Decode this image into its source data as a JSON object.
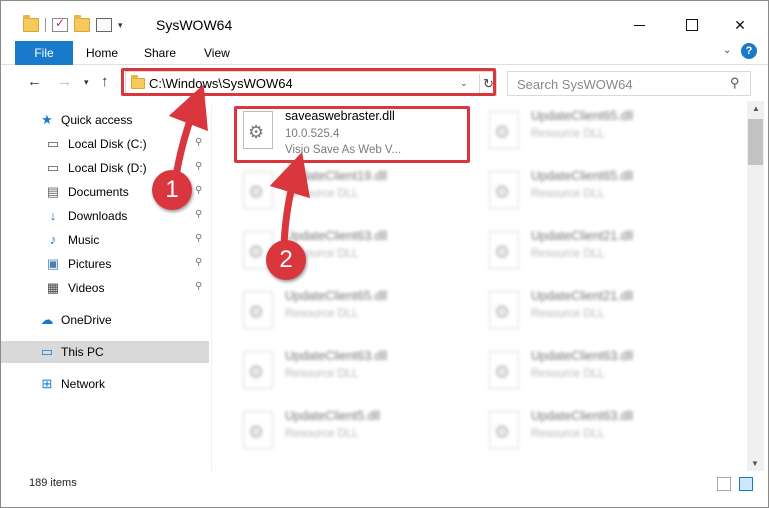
{
  "window": {
    "title": "SysWOW64",
    "minimize_glyph": "",
    "maximize_glyph": "",
    "close_glyph": "✕"
  },
  "ribbon": {
    "tabs": [
      "File",
      "Home",
      "Share",
      "View"
    ],
    "collapse_glyph": "⌄",
    "help_glyph": "?"
  },
  "nav": {
    "back_glyph": "←",
    "forward_glyph": "→",
    "recent_glyph": "▾",
    "up_glyph": "↑",
    "address": "C:\\Windows\\SysWOW64",
    "address_dropdown_glyph": "⌄",
    "refresh_glyph": "↻",
    "search_placeholder": "Search SysWOW64",
    "search_glyph": "⚲"
  },
  "sidebar": {
    "quick_access": "Quick access",
    "pinned": [
      {
        "label": "Local Disk (C:)",
        "icon": "drive-icon"
      },
      {
        "label": "Local Disk (D:)",
        "icon": "drive-icon"
      },
      {
        "label": "Documents",
        "icon": "documents-icon"
      },
      {
        "label": "Downloads",
        "icon": "downloads-icon"
      },
      {
        "label": "Music",
        "icon": "music-icon"
      },
      {
        "label": "Pictures",
        "icon": "pictures-icon"
      },
      {
        "label": "Videos",
        "icon": "videos-icon"
      }
    ],
    "onedrive": "OneDrive",
    "this_pc": "This PC",
    "network": "Network",
    "pin_glyph": "📌"
  },
  "files": [
    {
      "name": "saveaswebraster.dll",
      "line2": "10.0.525.4",
      "line3": "Visio Save As Web V...",
      "highlighted": true
    },
    {
      "name": "UpdateClient65.dll",
      "line2": "Resource DLL"
    },
    {
      "name": "UpdateClient19.dll",
      "line2": "Resource DLL"
    },
    {
      "name": "UpdateClient65.dll",
      "line2": "Resource DLL"
    },
    {
      "name": "UpdateClient63.dll",
      "line2": "Resource DLL"
    },
    {
      "name": "UpdateClient21.dll",
      "line2": "Resource DLL"
    },
    {
      "name": "UpdateClient65.dll",
      "line2": "Resource DLL"
    },
    {
      "name": "UpdateClient21.dll",
      "line2": "Resource DLL"
    },
    {
      "name": "UpdateClient63.dll",
      "line2": "Resource DLL"
    },
    {
      "name": "UpdateClient63.dll",
      "line2": "Resource DLL"
    },
    {
      "name": "UpdateClient5.dll",
      "line2": "Resource DLL"
    },
    {
      "name": "UpdateClient63.dll",
      "line2": "Resource DLL"
    }
  ],
  "status": {
    "item_count": "189 items"
  },
  "annotations": {
    "step1": "1",
    "step2": "2",
    "color": "#d9363e"
  },
  "colors": {
    "accent": "#1979ca",
    "selection": "#cce8ff",
    "highlight": "#d9363e"
  }
}
